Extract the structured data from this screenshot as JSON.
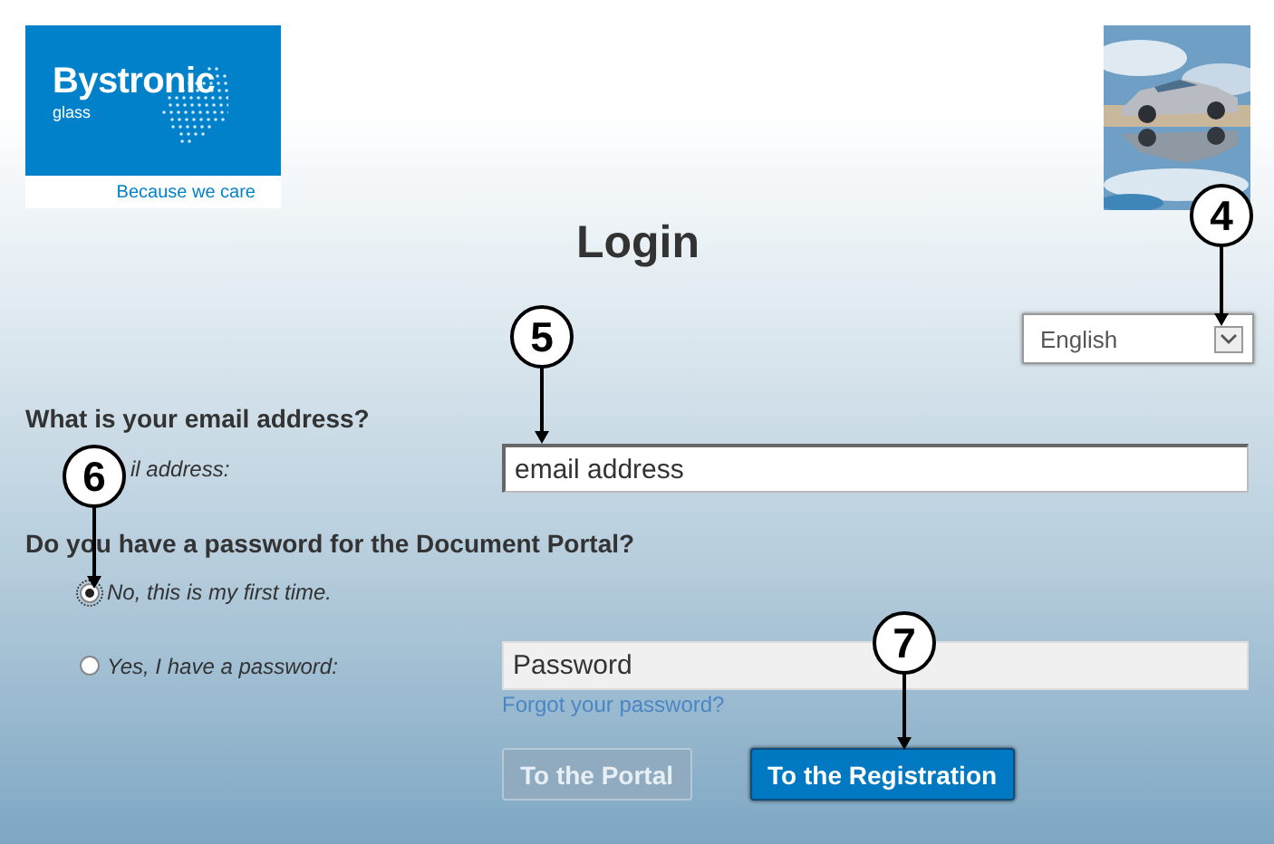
{
  "logo": {
    "brand": "Bystronic",
    "sub": "glass",
    "tagline": "Because we care"
  },
  "title": "Login",
  "language": {
    "value": "English"
  },
  "email_section": {
    "heading": "What is your email address?",
    "label": "il address:",
    "field": {
      "value": "email address"
    }
  },
  "password_section": {
    "heading": "Do you have a password for the Document Portal?",
    "options": [
      {
        "label": "No, this is my first time.",
        "selected": true
      },
      {
        "label": "Yes, I have a password:",
        "selected": false
      }
    ],
    "password_field": {
      "value": "Password",
      "disabled": true
    },
    "forgot_link": "Forgot your password?"
  },
  "buttons": [
    {
      "label": "To the Portal",
      "disabled": true
    },
    {
      "label": "To the Registration",
      "disabled": false
    }
  ],
  "callouts": [
    {
      "number": "4"
    },
    {
      "number": "5"
    },
    {
      "number": "6"
    },
    {
      "number": "7"
    }
  ]
}
